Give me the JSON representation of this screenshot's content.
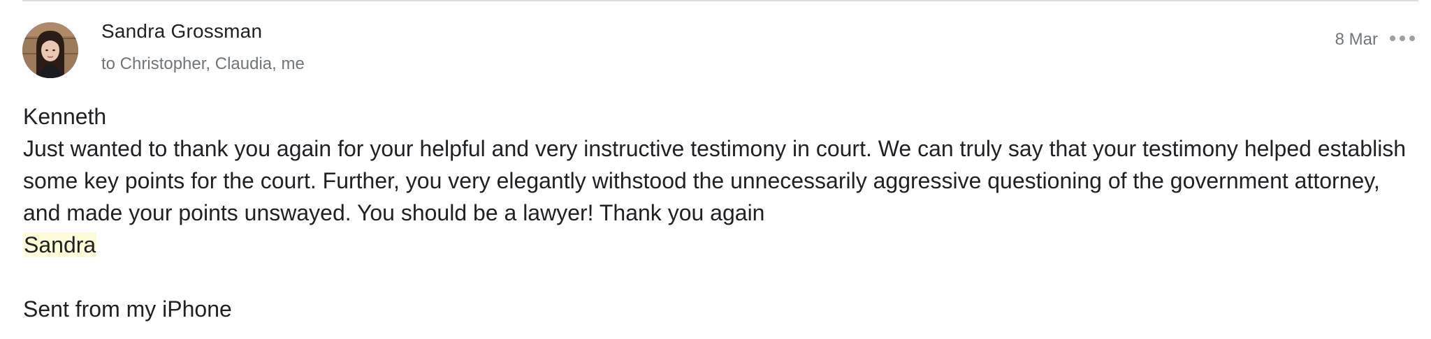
{
  "email": {
    "sender_name": "Sandra Grossman",
    "recipients": "to Christopher, Claudia, me",
    "date": "8 Mar",
    "greeting": "Kenneth",
    "body": "Just wanted to thank you again for your helpful and very instructive testimony in court. We can truly say that your testimony helped establish some key points for the court. Further, you very elegantly withstood the unnecessarily aggressive questioning of the government attorney, and made your points unswayed. You should be a lawyer! Thank you again",
    "signature": "Sandra",
    "footer": "Sent from my iPhone"
  },
  "colors": {
    "signature_highlight": "#fefbd8",
    "meta_text": "#70757a",
    "main_text": "#202124"
  },
  "icons": {
    "more": "more-horizontal-icon",
    "avatar": "sender-avatar"
  }
}
